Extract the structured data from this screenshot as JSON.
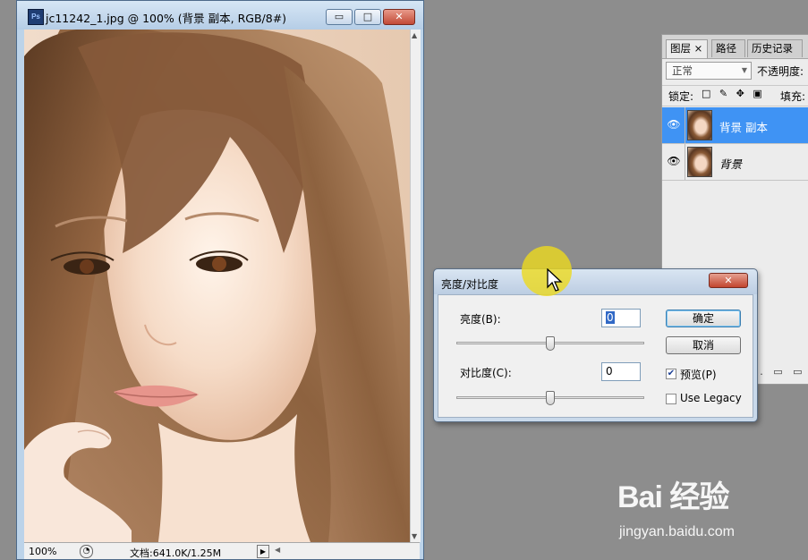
{
  "document_window": {
    "title": "jc11242_1.jpg @ 100% (背景 副本, RGB/8#)",
    "app_icon_text": "Ps",
    "controls": {
      "minimize": "▭",
      "maximize": "□",
      "close": "✕"
    },
    "status_bar": {
      "zoom": "100%",
      "doc_info": "文档:641.0K/1.25M",
      "menu_arrow": "▶",
      "scroll_left": "◀"
    }
  },
  "layers_panel": {
    "tabs": [
      {
        "label": "图层 ×"
      },
      {
        "label": "路径"
      },
      {
        "label": "历史记录"
      }
    ],
    "blend_mode": "正常",
    "opacity_label": "不透明度:",
    "lock_label": "锁定:",
    "lock_icons": "□ ✎ ✥ ▣",
    "fill_label": "填充:",
    "layers": [
      {
        "name": "背景 副本",
        "selected": true
      },
      {
        "name": "背景",
        "selected": false
      }
    ],
    "bottom_icons": "⊕. ▭ ▭"
  },
  "dialog": {
    "title": "亮度/对比度",
    "close": "✕",
    "brightness": {
      "label": "亮度(B):",
      "value": "0",
      "level": 0.5
    },
    "contrast": {
      "label": "对比度(C):",
      "value": "0",
      "level": 0.5
    },
    "ok_label": "确定",
    "cancel_label": "取消",
    "preview": {
      "label": "预览(P)",
      "checked": true
    },
    "use_legacy": {
      "label": "Use Legacy",
      "checked": false
    }
  },
  "watermark": {
    "brand": "Bai 经验",
    "url": "jingyan.baidu.com"
  },
  "colors": {
    "selection": "#3f93f4",
    "background": "#8d8d8d",
    "highlight": "#ecda1e"
  }
}
